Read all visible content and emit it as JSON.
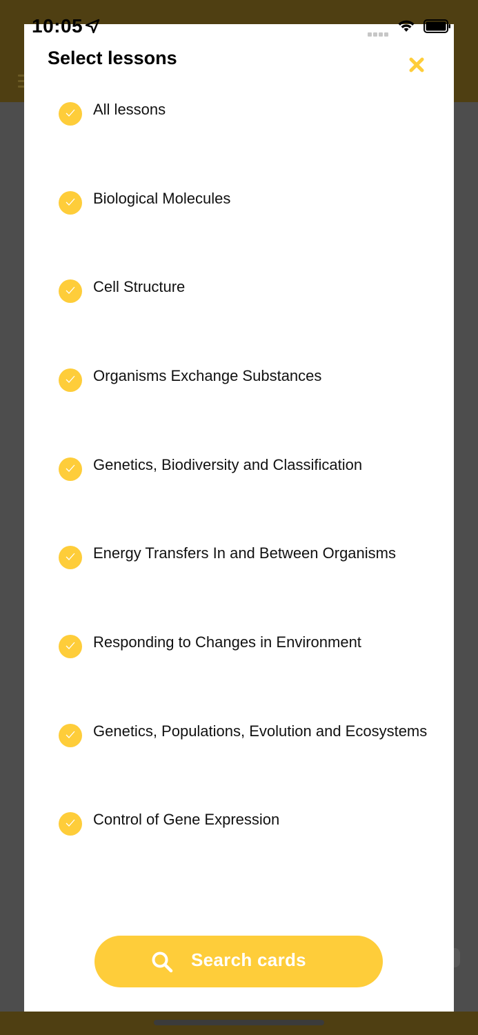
{
  "status_bar": {
    "time": "10:05"
  },
  "modal": {
    "title": "Select lessons",
    "close_icon": "close-icon",
    "lessons": [
      {
        "label": "All lessons",
        "checked": true
      },
      {
        "label": "Biological Molecules",
        "checked": true
      },
      {
        "label": "Cell Structure",
        "checked": true
      },
      {
        "label": "Organisms Exchange Substances",
        "checked": true
      },
      {
        "label": "Genetics, Biodiversity and Classification",
        "checked": true
      },
      {
        "label": "Energy Transfers In and Between Organisms",
        "checked": true
      },
      {
        "label": "Responding to Changes in Environment",
        "checked": true
      },
      {
        "label": "Genetics, Populations, Evolution and Ecosystems",
        "checked": true
      },
      {
        "label": "Control of Gene Expression",
        "checked": true
      }
    ],
    "search_button": {
      "label": "Search cards",
      "icon": "search-icon"
    }
  },
  "colors": {
    "accent": "#fecd3a",
    "header_dimmed": "#4f3f12",
    "overlay": "#4d4d4d"
  }
}
